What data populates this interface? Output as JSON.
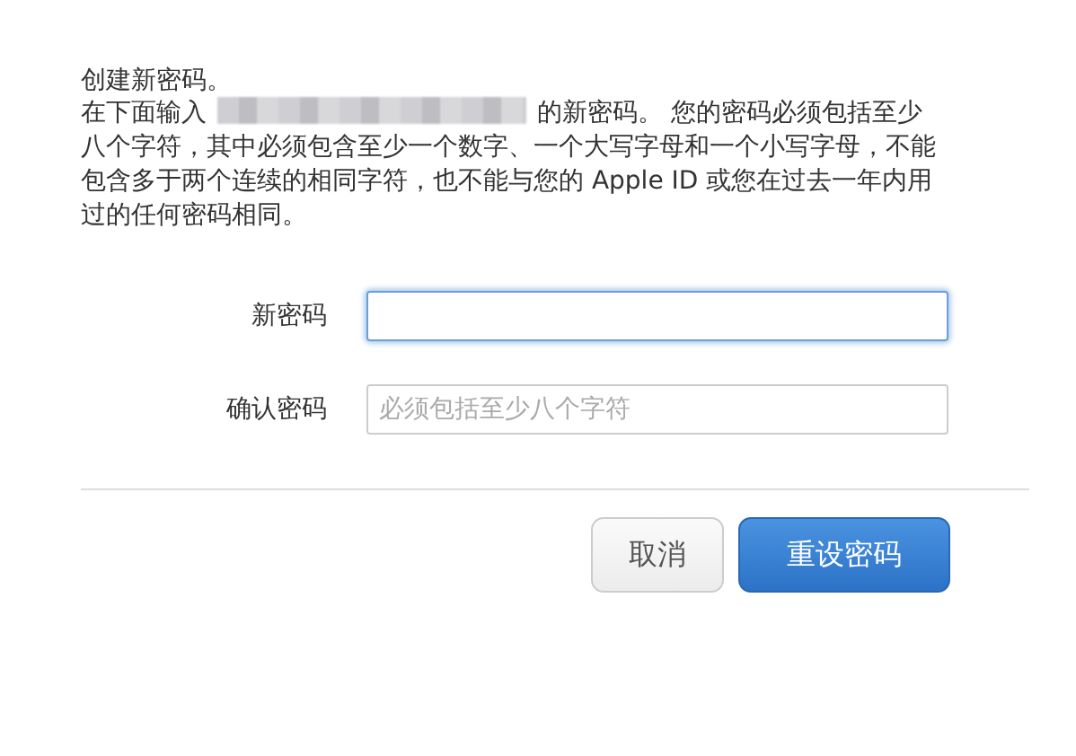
{
  "heading": "创建新密码。",
  "intro": {
    "before_redacted": "在下面输入",
    "after_redacted": "的新密码。 您的密码必须包括至少八个字符，其中必须包含至少一个数字、一个大写字母和一个小写字母，不能包含多于两个连续的相同字符，也不能与您的 Apple ID 或您在过去一年内用过的任何密码相同。"
  },
  "fields": [
    {
      "label": "新密码",
      "focused": true
    },
    {
      "label": "确认密码",
      "placeholder": "必须包括至少八个字符",
      "focused": false
    }
  ],
  "buttons": [
    {
      "label": "取消",
      "kind": "secondary"
    },
    {
      "label": "重设密码",
      "kind": "primary"
    }
  ]
}
